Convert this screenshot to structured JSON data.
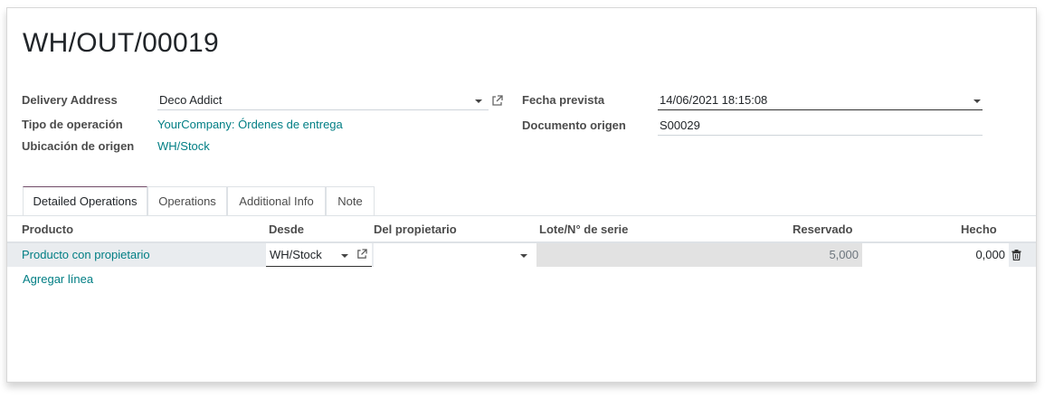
{
  "record": {
    "title": "WH/OUT/00019"
  },
  "fields": {
    "delivery_address_label": "Delivery Address",
    "delivery_address_value": "Deco Addict",
    "operation_type_label": "Tipo de operación",
    "operation_type_value": "YourCompany: Órdenes de entrega",
    "source_location_label": "Ubicación de origen",
    "source_location_value": "WH/Stock",
    "scheduled_date_label": "Fecha prevista",
    "scheduled_date_value": "14/06/2021 18:15:08",
    "source_document_label": "Documento origen",
    "source_document_value": "S00029"
  },
  "tabs": [
    {
      "label": "Detailed Operations",
      "active": true
    },
    {
      "label": "Operations",
      "active": false
    },
    {
      "label": "Additional Info",
      "active": false
    },
    {
      "label": "Note",
      "active": false
    }
  ],
  "table": {
    "columns": [
      "Producto",
      "Desde",
      "Del propietario",
      "Lote/N° de serie",
      "Reservado",
      "Hecho"
    ],
    "rows": [
      {
        "product": "Producto con propietario",
        "from": "WH/Stock",
        "owner": "",
        "lot": "",
        "reserved": "5,000",
        "done": "0,000"
      }
    ],
    "add_line_label": "Agregar línea"
  },
  "colors": {
    "link": "#017e84",
    "tab_active_border": "#714b67",
    "row_bg": "#e9ecef"
  },
  "icons": {
    "external": "external-link-icon",
    "dropdown": "caret-down-icon",
    "delete": "trash-icon"
  }
}
